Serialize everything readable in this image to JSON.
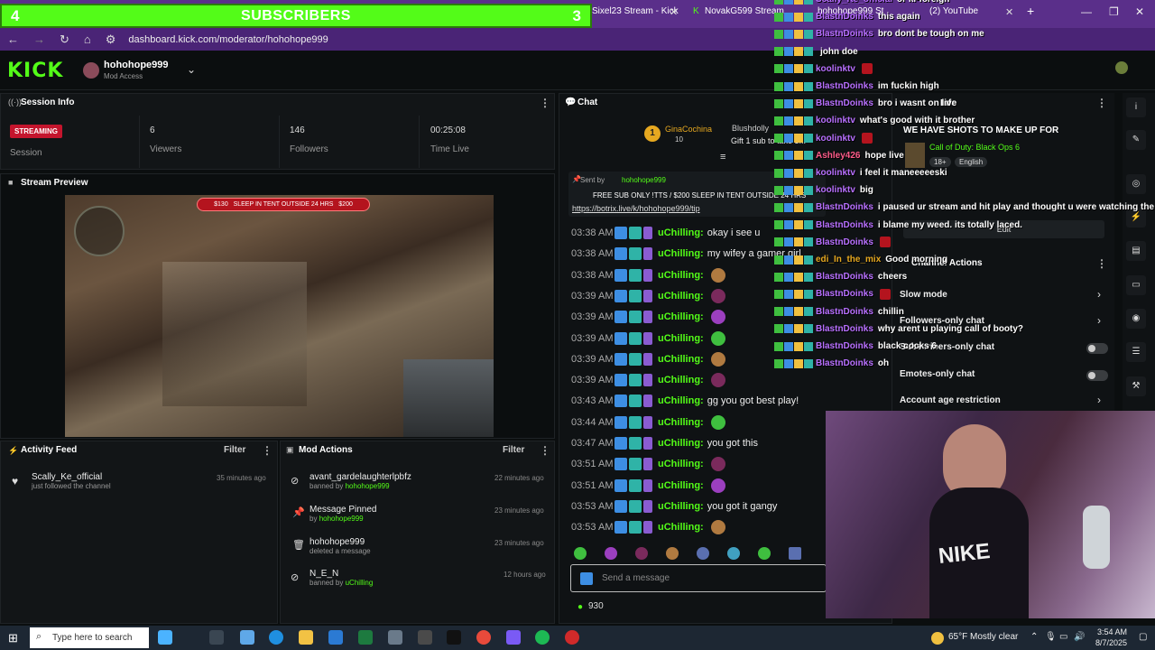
{
  "browser": {
    "subs_banner": {
      "left_num": "4",
      "title": "SUBSCRIBERS",
      "right_num": "3"
    },
    "tabs": [
      {
        "label": "Sixel23 Stream - Kick"
      },
      {
        "label": "NovakG599 Stream"
      },
      {
        "label": "hohohope999 St"
      },
      {
        "label": "(2) YouTube"
      }
    ],
    "url": "dashboard.kick.com/moderator/hohohope999"
  },
  "header": {
    "logo": "KICK",
    "channel_name": "hohohope999",
    "channel_role": "Mod Access"
  },
  "session": {
    "title": "Session Info",
    "status": "STREAMING",
    "session_label": "Session",
    "viewers_value": "6",
    "viewers_label": "Viewers",
    "followers_value": "146",
    "followers_label": "Followers",
    "time_value": "00:25:08",
    "time_label": "Time Live"
  },
  "preview": {
    "title": "Stream Preview",
    "banner_left": "$130",
    "banner_text": "SLEEP IN TENT OUTSIDE 24 HRS",
    "banner_right": "$200"
  },
  "activity": {
    "title": "Activity Feed",
    "filter": "Filter",
    "items": [
      {
        "name": "Scally_Ke_official",
        "desc": "just followed the channel",
        "time": "35 minutes ago"
      }
    ]
  },
  "modactions": {
    "title": "Mod Actions",
    "filter": "Filter",
    "items": [
      {
        "name": "avant_gardelaughterlpbfz",
        "prefix": "banned by",
        "by": "hohohope999",
        "time": "22 minutes ago"
      },
      {
        "name": "Message Pinned",
        "prefix": "by",
        "by": "hohohope999",
        "time": "23 minutes ago"
      },
      {
        "name": "hohohope999",
        "prefix": "deleted a message",
        "by": "",
        "time": "23 minutes ago"
      },
      {
        "name": "N_E_N",
        "prefix": "banned by",
        "by": "uChilling",
        "time": "12 hours ago"
      }
    ]
  },
  "chat": {
    "title": "Chat",
    "top_user": "GinaCochina",
    "top_user_count": "10",
    "gift_user": "Blushdolly",
    "gift_text": "Gift 1 sub to take 3...",
    "pinned_by_label": "Sent by",
    "pinned_by": "hohohope999",
    "pinned_text": "FREE SUB ONLY !TTS / $200 SLEEP IN TENT OUTSIDE 24 HRS",
    "pinned_link": "https://botrix.live/k/hohohope999/tip",
    "messages": [
      {
        "time": "03:38 AM",
        "user": "uChilling:",
        "msg": "okay i see u"
      },
      {
        "time": "03:38 AM",
        "user": "uChilling:",
        "msg": "my wifey a gamer girl"
      },
      {
        "time": "03:38 AM",
        "user": "uChilling:",
        "msg": ""
      },
      {
        "time": "03:39 AM",
        "user": "uChilling:",
        "msg": ""
      },
      {
        "time": "03:39 AM",
        "user": "uChilling:",
        "msg": ""
      },
      {
        "time": "03:39 AM",
        "user": "uChilling:",
        "msg": ""
      },
      {
        "time": "03:39 AM",
        "user": "uChilling:",
        "msg": ""
      },
      {
        "time": "03:39 AM",
        "user": "uChilling:",
        "msg": ""
      },
      {
        "time": "03:43 AM",
        "user": "uChilling:",
        "msg": "gg you got best play!"
      },
      {
        "time": "03:44 AM",
        "user": "uChilling:",
        "msg": ""
      },
      {
        "time": "03:47 AM",
        "user": "uChilling:",
        "msg": "you got this"
      },
      {
        "time": "03:51 AM",
        "user": "uChilling:",
        "msg": ""
      },
      {
        "time": "03:51 AM",
        "user": "uChilling:",
        "msg": ""
      },
      {
        "time": "03:53 AM",
        "user": "uChilling:",
        "msg": "you got it gangy"
      },
      {
        "time": "03:53 AM",
        "user": "uChilling:",
        "msg": ""
      }
    ],
    "input_placeholder": "Send a message",
    "points": "930"
  },
  "overlay_chat": [
    {
      "user": "Scally_Ke_official",
      "msg": "or ki-foreign"
    },
    {
      "user": "BlastnDoinks",
      "msg": "this again"
    },
    {
      "user": "BlastnDoinks",
      "msg": "bro dont be tough on me"
    },
    {
      "user": "",
      "msg": "john doe"
    },
    {
      "user": "koolinktv",
      "msg": ""
    },
    {
      "user": "BlastnDoinks",
      "msg": "im fuckin high"
    },
    {
      "user": "BlastnDoinks",
      "msg": "bro i wasnt on live"
    },
    {
      "user": "koolinktv",
      "msg": "what's good with it brother"
    },
    {
      "user": "koolinktv",
      "msg": ""
    },
    {
      "user": "Ashley426",
      "msg": "hope live"
    },
    {
      "user": "koolinktv",
      "msg": "i feel it maneeeeeski"
    },
    {
      "user": "koolinktv",
      "msg": "big"
    },
    {
      "user": "BlastnDoinks",
      "msg": "i paused ur stream and hit play and thought u were watching the sam"
    },
    {
      "user": "BlastnDoinks",
      "msg": "i blame my weed. its totally laced."
    },
    {
      "user": "BlastnDoinks",
      "msg": ""
    },
    {
      "user": "edi_In_the_mix",
      "msg": "Good morning"
    },
    {
      "user": "BlastnDoinks",
      "msg": "cheers"
    },
    {
      "user": "BlastnDoinks",
      "msg": ""
    },
    {
      "user": "BlastnDoinks",
      "msg": "chillin"
    },
    {
      "user": "BlastnDoinks",
      "msg": "why arent u playing call of booty?"
    },
    {
      "user": "BlastnDoinks",
      "msg": "black cocks 6"
    },
    {
      "user": "BlastnDoinks",
      "msg": "oh"
    }
  ],
  "stream_info": {
    "title_partial": "Info",
    "stream_title": "WE HAVE SHOTS TO MAKE UP FOR",
    "category": "Call of Duty: Black Ops 6",
    "tag1": "18+",
    "tag2": "English",
    "edit": "Edit"
  },
  "channel_actions": {
    "title": "Channel Actions",
    "options": [
      "Slow mode",
      "Followers-only chat",
      "Subscribers-only chat",
      "Emotes-only chat",
      "Account age restriction"
    ]
  },
  "webcam": {
    "shirt_text": "NIKE"
  },
  "taskbar": {
    "search_placeholder": "Type here to search",
    "weather": "65°F  Mostly clear",
    "time": "3:54 AM",
    "date": "8/7/2025"
  },
  "colors": {
    "kick_green": "#53fc18",
    "streaming_red": "#c4152d",
    "browser_purple": "#5a2f8a"
  }
}
